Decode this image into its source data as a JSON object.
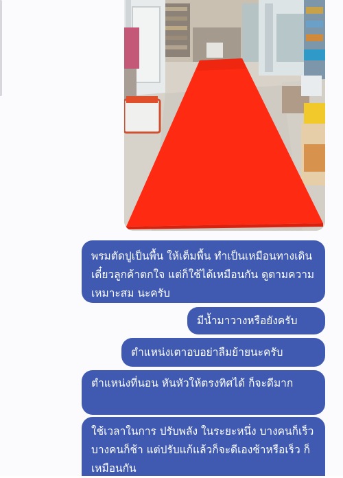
{
  "conversation": {
    "photo": {
      "description_icon": "photo-attachment-icon"
    },
    "messages": [
      {
        "text": "พรมตัดปูเป็นพื้น ให้เต็มพื้น ทำเป็นเหมือนทางเดินเดี๋ยวลูกค้าตกใจ แต่ก็ใช้ได้เหมือนกัน ดูตามความเหมาะสม นะครับ"
      },
      {
        "text": "มีน้ำมาวางหรือยังครับ"
      },
      {
        "text": "ตำแหน่งเตาอบอย่าลืมย้ายนะครับ"
      },
      {
        "text": "ตำแหน่งที่นอน หันหัวให้ตรงทิศได้ ก็จะดีมาก"
      },
      {
        "text": "ใช้เวลาในการ ปรับพลัง ในระยะหนึ่ง บางคนก็เร็วบางคนก็ช้า แต่ปรับแก้แล้วก็จะดีเองช้าหรือเร็ว ก็เหมือนกัน"
      }
    ],
    "colors": {
      "bubble": "#3f5ab0",
      "bubble_text": "#ffffff",
      "carpet": "#ff2a12"
    }
  }
}
